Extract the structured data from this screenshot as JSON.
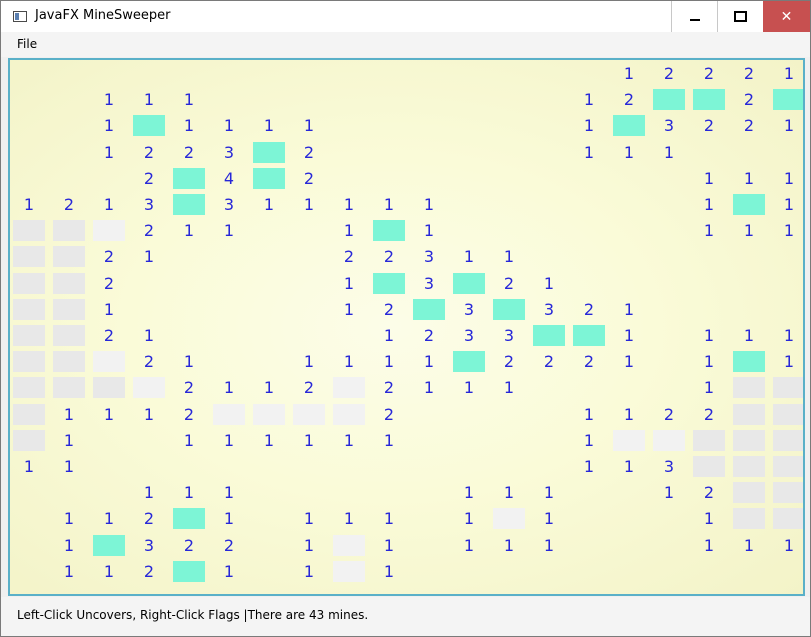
{
  "window": {
    "title": "JavaFX MineSweeper",
    "controls": {
      "minimize": "—",
      "maximize": "□",
      "close": "✕"
    },
    "close_color": "#c75050"
  },
  "menu": {
    "items": [
      {
        "label": "File"
      }
    ]
  },
  "status": {
    "text": "Left-Click Uncovers, Right-Click Flags |There are 43 mines."
  },
  "board": {
    "columns": 20,
    "number_color": "#2727d8",
    "highlight_color": "#7df5d6",
    "background_color": "#fafbd8",
    "rows": [
      [
        " ",
        " ",
        " ",
        " ",
        " ",
        " ",
        " ",
        " ",
        " ",
        " ",
        " ",
        " ",
        " ",
        " ",
        " ",
        "1",
        "2",
        "2",
        "2",
        "1"
      ],
      [
        " ",
        " ",
        "1",
        "1",
        "1",
        " ",
        " ",
        " ",
        " ",
        " ",
        " ",
        " ",
        " ",
        " ",
        "1",
        "2",
        "M",
        "M",
        "2",
        "M"
      ],
      [
        " ",
        " ",
        "1",
        "M",
        "1",
        "1",
        "1",
        "1",
        " ",
        " ",
        " ",
        " ",
        " ",
        " ",
        "1",
        "M",
        "3",
        "2",
        "2",
        "1"
      ],
      [
        " ",
        " ",
        "1",
        "2",
        "2",
        "3",
        "M",
        "2",
        " ",
        " ",
        " ",
        " ",
        " ",
        " ",
        "1",
        "1",
        "1",
        " ",
        " ",
        " "
      ],
      [
        " ",
        " ",
        " ",
        "2",
        "M",
        "4",
        "M",
        "2",
        " ",
        " ",
        " ",
        " ",
        " ",
        " ",
        " ",
        " ",
        " ",
        "1",
        "1",
        "1"
      ],
      [
        "1",
        "2",
        "1",
        "3",
        "M",
        "3",
        "1",
        "1",
        "1",
        "1",
        "1",
        " ",
        " ",
        " ",
        " ",
        " ",
        " ",
        "1",
        "M",
        "1"
      ],
      [
        "C",
        "C",
        "L",
        "2",
        "1",
        "1",
        " ",
        " ",
        "1",
        "M",
        "1",
        " ",
        " ",
        " ",
        " ",
        " ",
        " ",
        "1",
        "1",
        "1"
      ],
      [
        "C",
        "C",
        "2",
        "1",
        " ",
        " ",
        " ",
        " ",
        "2",
        "2",
        "3",
        "1",
        "1",
        " ",
        " ",
        " ",
        " ",
        " ",
        " ",
        " "
      ],
      [
        "C",
        "C",
        "2",
        " ",
        " ",
        " ",
        " ",
        " ",
        "1",
        "M",
        "3",
        "M",
        "2",
        "1",
        " ",
        " ",
        " ",
        " ",
        " ",
        " "
      ],
      [
        "C",
        "C",
        "1",
        " ",
        " ",
        " ",
        " ",
        " ",
        "1",
        "2",
        "M",
        "3",
        "M",
        "3",
        "2",
        "1",
        " ",
        " ",
        " ",
        " "
      ],
      [
        "C",
        "C",
        "2",
        "1",
        " ",
        " ",
        " ",
        " ",
        " ",
        "1",
        "2",
        "3",
        "3",
        "M",
        "M",
        "1",
        " ",
        "1",
        "1",
        "1"
      ],
      [
        "C",
        "C",
        "L",
        "2",
        "1",
        " ",
        " ",
        "1",
        "1",
        "1",
        "1",
        "M",
        "2",
        "2",
        "2",
        "1",
        " ",
        "1",
        "M",
        "1"
      ],
      [
        "C",
        "C",
        "C",
        "L",
        "2",
        "1",
        "1",
        "2",
        "L",
        "2",
        "1",
        "1",
        "1",
        " ",
        " ",
        " ",
        " ",
        "1",
        "C",
        "C"
      ],
      [
        "C",
        "1",
        "1",
        "1",
        "2",
        "L",
        "L",
        "L",
        "L",
        "2",
        " ",
        " ",
        " ",
        " ",
        "1",
        "1",
        "2",
        "2",
        "C",
        "C"
      ],
      [
        "C",
        "1",
        " ",
        " ",
        "1",
        "1",
        "1",
        "1",
        "1",
        "1",
        " ",
        " ",
        " ",
        " ",
        "1",
        "L",
        "L",
        "C",
        "C",
        "C"
      ],
      [
        "1",
        "1",
        " ",
        " ",
        " ",
        " ",
        " ",
        " ",
        " ",
        " ",
        " ",
        " ",
        " ",
        " ",
        "1",
        "1",
        "3",
        "C",
        "C",
        "C"
      ],
      [
        " ",
        " ",
        " ",
        "1",
        "1",
        "1",
        " ",
        " ",
        " ",
        " ",
        " ",
        "1",
        "1",
        "1",
        " ",
        " ",
        "1",
        "2",
        "C",
        "C"
      ],
      [
        " ",
        "1",
        "1",
        "2",
        "M",
        "1",
        " ",
        "1",
        "1",
        "1",
        " ",
        "1",
        "L",
        "1",
        " ",
        " ",
        " ",
        "1",
        "C",
        "C"
      ],
      [
        " ",
        "1",
        "M",
        "3",
        "2",
        "2",
        " ",
        "1",
        "L",
        "1",
        " ",
        "1",
        "1",
        "1",
        " ",
        " ",
        " ",
        "1",
        "1",
        "1"
      ],
      [
        " ",
        "1",
        "1",
        "2",
        "M",
        "1",
        " ",
        "1",
        "L",
        "1",
        " ",
        " ",
        " ",
        " ",
        " ",
        " ",
        " ",
        " ",
        " ",
        " "
      ]
    ]
  }
}
